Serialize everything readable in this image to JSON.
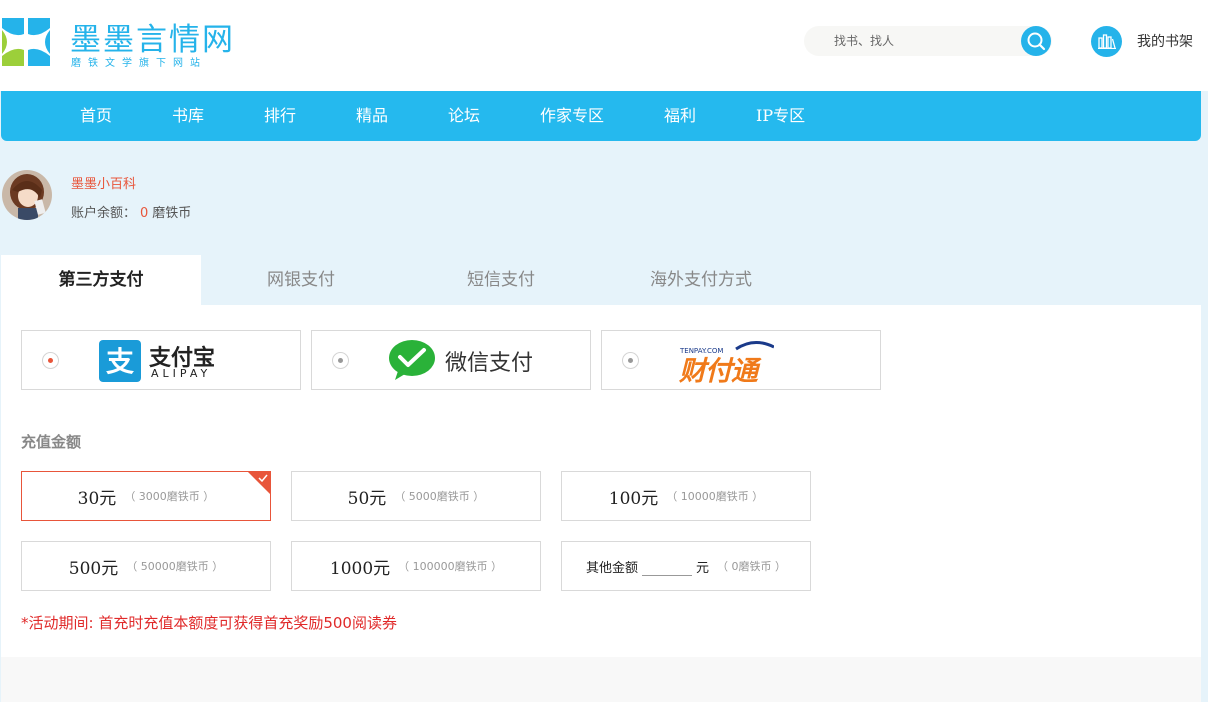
{
  "site": {
    "title": "墨墨言情网",
    "subtitle": "磨铁文学旗下网站"
  },
  "search": {
    "placeholder": "找书、找人"
  },
  "bookshelf": {
    "label": "我的书架"
  },
  "nav": {
    "items": [
      {
        "label": "首页"
      },
      {
        "label": "书库"
      },
      {
        "label": "排行"
      },
      {
        "label": "精品"
      },
      {
        "label": "论坛"
      },
      {
        "label": "作家专区"
      },
      {
        "label": "福利"
      },
      {
        "label": "IP专区"
      }
    ]
  },
  "user": {
    "name": "墨墨小百科",
    "balance_label": "账户余额：",
    "balance_value": "0",
    "balance_unit": "磨铁币"
  },
  "tabs": [
    {
      "label": "第三方支付",
      "active": true
    },
    {
      "label": "网银支付",
      "active": false
    },
    {
      "label": "短信支付",
      "active": false
    },
    {
      "label": "海外支付方式",
      "active": false
    }
  ],
  "payment_methods": [
    {
      "name": "支付宝",
      "sub": "ALIPAY",
      "selected": true
    },
    {
      "name": "微信支付",
      "selected": false
    },
    {
      "name": "财付通",
      "sub": "TENPAY.COM",
      "selected": false
    }
  ],
  "amount": {
    "title": "充值金额",
    "options": [
      {
        "main": "30元",
        "sub": "（ 3000磨铁币 ）",
        "selected": true
      },
      {
        "main": "50元",
        "sub": "（ 5000磨铁币 ）",
        "selected": false
      },
      {
        "main": "100元",
        "sub": "（ 10000磨铁币 ）",
        "selected": false
      },
      {
        "main": "500元",
        "sub": "（ 50000磨铁币 ）",
        "selected": false
      },
      {
        "main": "1000元",
        "sub": "（ 100000磨铁币 ）",
        "selected": false
      }
    ],
    "other": {
      "label": "其他金额",
      "value": "",
      "unit": "元",
      "sub": "（ 0磨铁币 ）"
    }
  },
  "notice": "*活动期间: 首充时充值本额度可获得首充奖励500阅读券",
  "colors": {
    "brand": "#25b3ea",
    "nav_bg": "#25b9ee",
    "accent": "#e8553a",
    "notice": "#e02a2a",
    "alipay": "#1a9bd8",
    "wechat": "#2ab239",
    "tenpay": "#f07a1a"
  }
}
